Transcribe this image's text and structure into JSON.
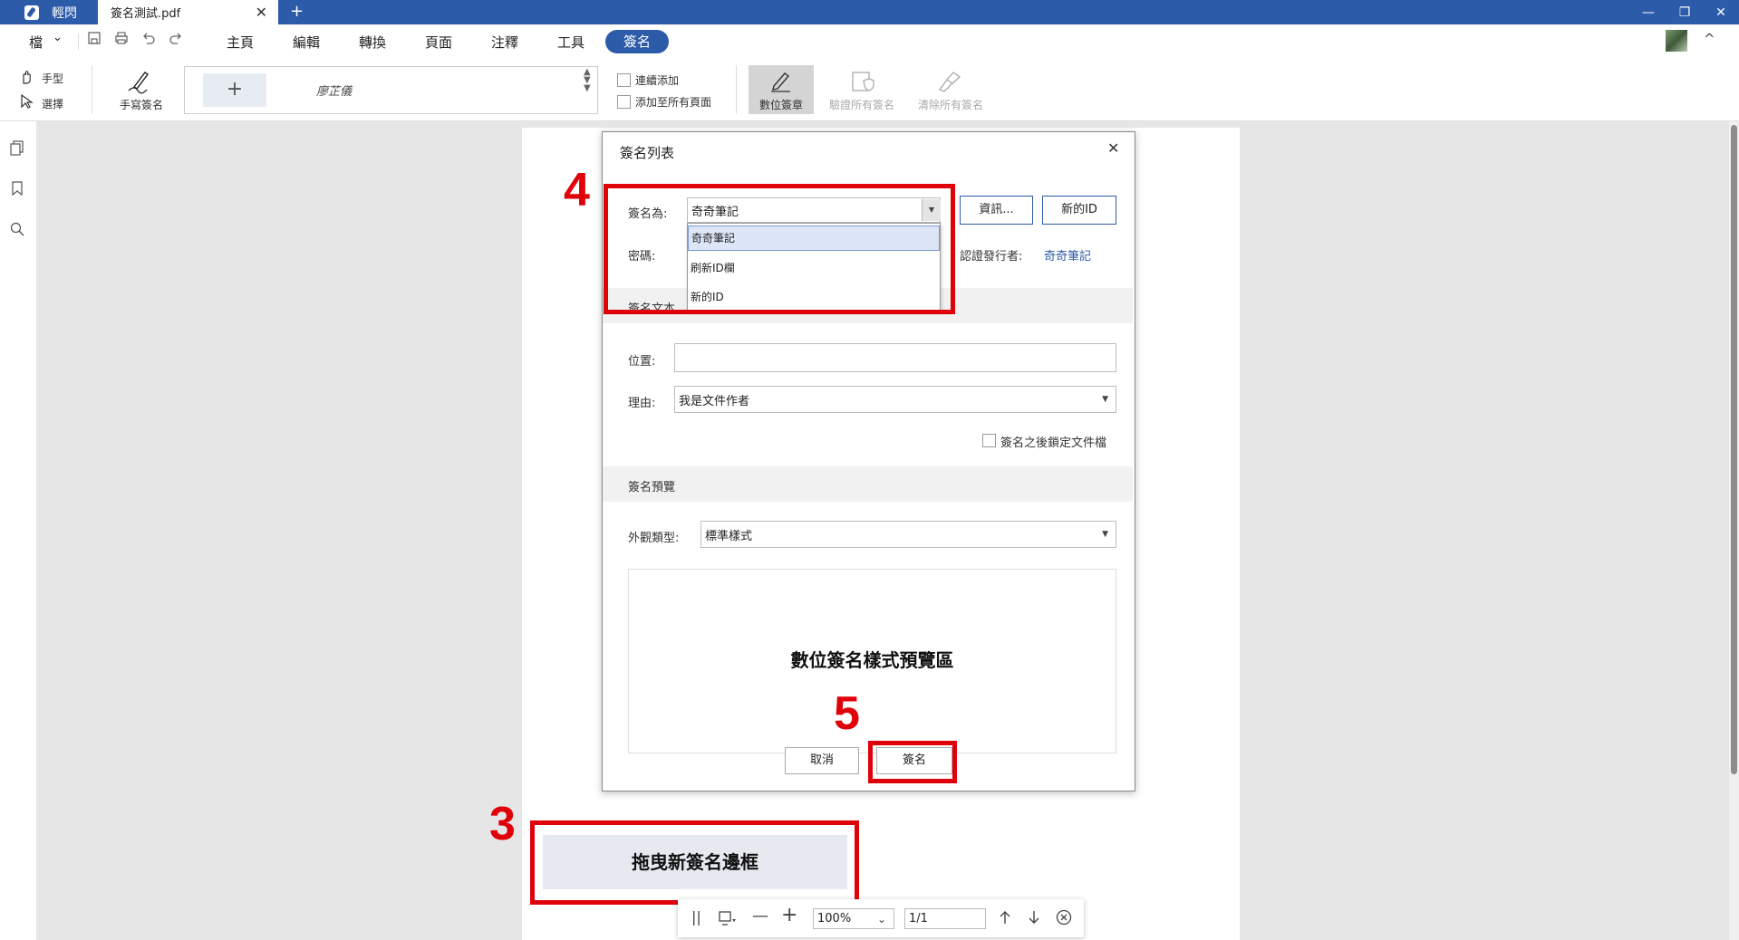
{
  "tabs": {
    "app_name": "輕閃",
    "doc_name": "簽名測試.pdf",
    "close": "✕",
    "new_tab": "+"
  },
  "window": {
    "minimize": "—",
    "restore": "❐",
    "close": "✕"
  },
  "menu": {
    "file": "檔",
    "file_arrow": "⌄",
    "items": [
      "主頁",
      "編輯",
      "轉換",
      "頁面",
      "注釋",
      "工具"
    ],
    "active": "簽名",
    "collapse": "^"
  },
  "toolbar": {
    "hand": "手型",
    "select": "選擇",
    "handwrite": "手寫簽名",
    "add_signature": "+",
    "signature_name": "廖芷儀",
    "continuous_add": "連續添加",
    "add_all_pages": "添加至所有頁面",
    "digital_sign": "數位簽章",
    "verify_all": "驗證所有簽名",
    "clear_all": "清除所有簽名"
  },
  "dialog": {
    "title": "簽名列表",
    "close": "✕",
    "sign_as_label": "簽名為:",
    "sign_as_value": "奇奇筆記",
    "dropdown_options": [
      "奇奇筆記",
      "刷新ID欄",
      "新的ID"
    ],
    "password_label": "密碼:",
    "info_button": "資訊...",
    "new_id_button": "新的ID",
    "issuer_label": "認證發行者:",
    "issuer_value": "奇奇筆記",
    "section_text": "簽名文本",
    "location_label": "位置:",
    "location_value": "",
    "reason_label": "理由:",
    "reason_value": "我是文件作者",
    "lock_after_sign": "簽名之後鎖定文件檔",
    "section_preview": "簽名預覽",
    "appearance_label": "外觀類型:",
    "appearance_value": "標準樣式",
    "preview_text": "數位簽名樣式預覽區",
    "cancel_button": "取消",
    "sign_button": "簽名"
  },
  "page_content": {
    "drag_box": "拖曳新簽名邊框"
  },
  "annotations": {
    "step3": "3",
    "step4": "4",
    "step5": "5"
  },
  "bottombar": {
    "zoom": "100%",
    "page": "1/1"
  },
  "colors": {
    "accent": "#2c5ba9",
    "annotation_red": "#e0000a"
  }
}
